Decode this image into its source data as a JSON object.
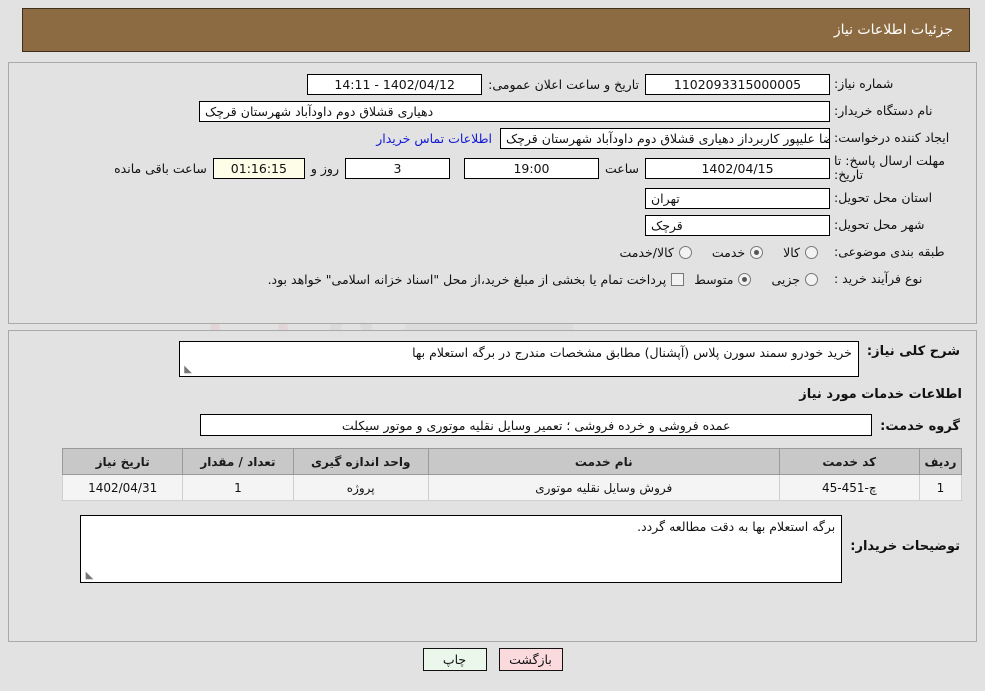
{
  "header": {
    "title": "جزئیات اطلاعات نیاز"
  },
  "form": {
    "need_no_label": "شماره نیاز:",
    "need_no_value": "1102093315000005",
    "org_label": "نام دستگاه خریدار:",
    "org_value": "دهیاری قشلاق دوم داودآباد شهرستان قرچک",
    "creator_label": "ایجاد کننده درخواست:",
    "creator_value": "رضا علیپور کاربرداز دهیاری قشلاق دوم داودآباد شهرستان قرچک",
    "contact_link": "اطلاعات تماس خریدار",
    "deadline_label": "مهلت ارسال پاسخ: تا تاریخ:",
    "deadline_date": "1402/04/15",
    "hour_label": "ساعت",
    "hour_value": "19:00",
    "days_value": "3",
    "days_unit": "روز و",
    "remaining_value": "01:16:15",
    "remaining_unit": "ساعت باقی مانده",
    "announce_label": "تاریخ و ساعت اعلان عمومی:",
    "announce_value": "1402/04/12 - 14:11",
    "province_label": "استان محل تحویل:",
    "province_value": "تهران",
    "city_label": "شهر محل تحویل:",
    "city_value": "قرچک",
    "category_label": "طبقه بندی موضوعی:",
    "category_options": [
      {
        "label": "کالا",
        "selected": false
      },
      {
        "label": "خدمت",
        "selected": true
      },
      {
        "label": "کالا/خدمت",
        "selected": false
      }
    ],
    "purchase_label": "نوع فرآیند خرید :",
    "purchase_options": [
      {
        "label": "جزیی",
        "selected": false
      },
      {
        "label": "متوسط",
        "selected": true
      }
    ],
    "treasury_checked": false,
    "treasury_text": "پرداخت تمام یا بخشی از مبلغ خرید،از محل \"اسناد خزانه اسلامی\" خواهد بود."
  },
  "body": {
    "need_desc_label": "شرح کلی نیاز:",
    "need_desc_value": "خرید خودرو سمند سورن پلاس (آپشنال) مطابق مشخصات مندرج در برگه استعلام بها",
    "services_title": "اطلاعات خدمات مورد نیاز",
    "group_label": "گروه خدمت:",
    "group_value": "عمده فروشی و خرده فروشی ؛ تعمیر وسایل نقلیه موتوری و موتور سیکلت",
    "notes_label": "توضیحات خریدار:",
    "notes_value": "برگه استعلام بها به دقت مطالعه گردد."
  },
  "table": {
    "headers": [
      "ردیف",
      "کد خدمت",
      "نام خدمت",
      "واحد اندازه گیری",
      "تعداد / مقدار",
      "تاریخ نیاز"
    ],
    "rows": [
      {
        "radif": "1",
        "code": "چ-451-45",
        "name": "فروش وسایل نقلیه موتوری",
        "unit": "پروژه",
        "qty": "1",
        "date": "1402/04/31"
      }
    ]
  },
  "footer": {
    "print_label": "چاپ",
    "back_label": "بازگشت"
  },
  "colors": {
    "header_bg": "#8c6b42",
    "link": "#1318d8",
    "print_btn": "#eaf7ea",
    "back_btn": "#fadadd"
  },
  "watermark": {
    "text": "AriaTender.net"
  }
}
